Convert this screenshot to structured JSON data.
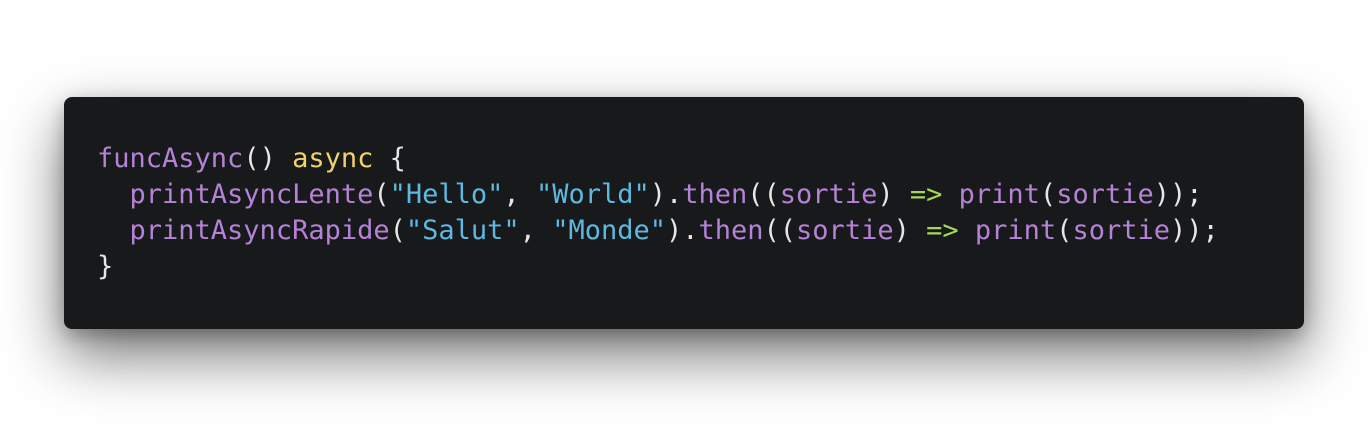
{
  "colors": {
    "background": "#ffffff",
    "editor_background": "#18191b",
    "function": "#b482d6",
    "keyword": "#f1d36b",
    "string": "#5fb8e0",
    "arrow": "#a6d65c",
    "punctuation": "#e6e6e6"
  },
  "code": {
    "line1": {
      "fn": "funcAsync",
      "paren": "() ",
      "kw": "async",
      "brace": " {"
    },
    "line2": {
      "indent": "  ",
      "fn": "printAsyncLente",
      "p1": "(",
      "s1": "\"Hello\"",
      "comma": ", ",
      "s2": "\"World\"",
      "p2": ").",
      "then": "then",
      "p3": "((",
      "arg": "sortie",
      "p4": ") ",
      "arrow": "=>",
      "sp": " ",
      "print": "print",
      "p5": "(",
      "arg2": "sortie",
      "p6": "));"
    },
    "line3": {
      "indent": "  ",
      "fn": "printAsyncRapide",
      "p1": "(",
      "s1": "\"Salut\"",
      "comma": ", ",
      "s2": "\"Monde\"",
      "p2": ").",
      "then": "then",
      "p3": "((",
      "arg": "sortie",
      "p4": ") ",
      "arrow": "=>",
      "sp": " ",
      "print": "print",
      "p5": "(",
      "arg2": "sortie",
      "p6": "));"
    },
    "line4": {
      "brace": "}"
    }
  }
}
